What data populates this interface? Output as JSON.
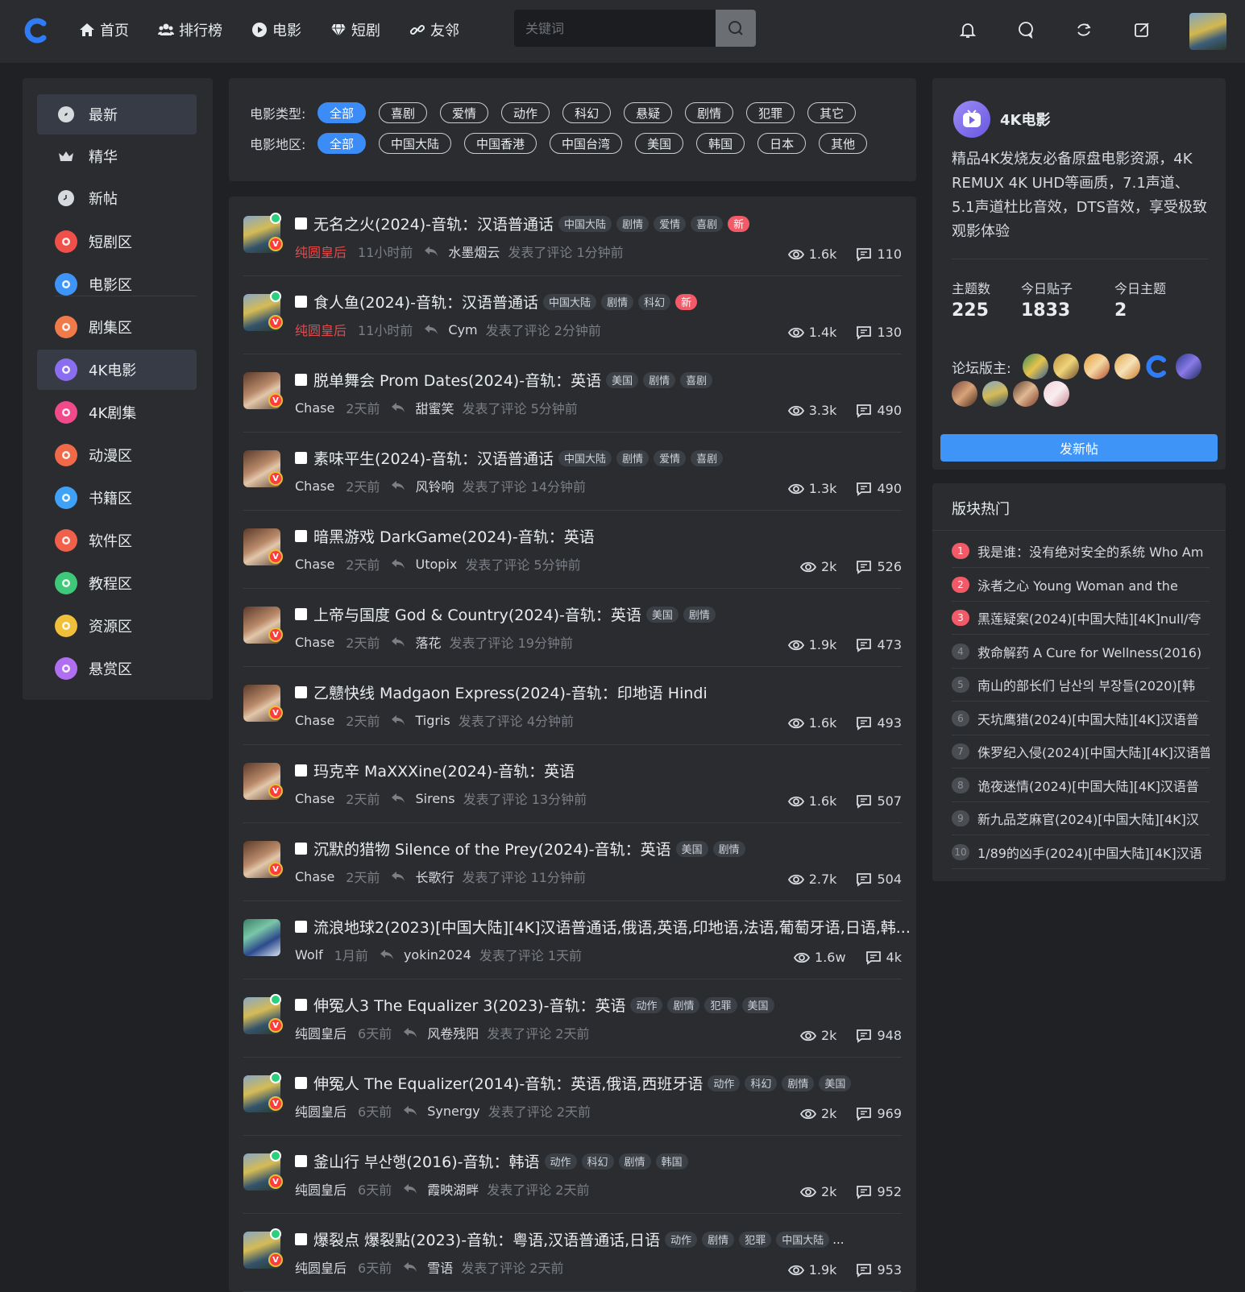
{
  "nav": {
    "items": [
      {
        "label": "首页",
        "icon": "home-icon"
      },
      {
        "label": "排行榜",
        "icon": "users-icon"
      },
      {
        "label": "电影",
        "icon": "play-circle-icon"
      },
      {
        "label": "短剧",
        "icon": "diamond-icon"
      },
      {
        "label": "友邻",
        "icon": "link-icon"
      }
    ],
    "search_placeholder": "关键词"
  },
  "sidebar": {
    "items": [
      {
        "label": "最新",
        "color": "#d6d9de"
      },
      {
        "label": "精华",
        "color": "#d6d9de"
      },
      {
        "label": "新帖",
        "color": "#d6d9de"
      },
      {
        "label": "短剧区",
        "color": "#f0504a"
      },
      {
        "label": "电影区",
        "color": "#3f94f7"
      },
      {
        "label": "剧集区",
        "color": "#f07a4a"
      },
      {
        "label": "4K电影",
        "color": "#8b6ef0"
      },
      {
        "label": "4K剧集",
        "color": "#f04a8a"
      },
      {
        "label": "动漫区",
        "color": "#f06a4a"
      },
      {
        "label": "书籍区",
        "color": "#3fa2f7"
      },
      {
        "label": "软件区",
        "color": "#f0604a"
      },
      {
        "label": "教程区",
        "color": "#3fc77a"
      },
      {
        "label": "资源区",
        "color": "#f0c03a"
      },
      {
        "label": "悬赏区",
        "color": "#b06ef0"
      }
    ]
  },
  "filters": {
    "type_label": "电影类型:",
    "types": [
      "全部",
      "喜剧",
      "爱情",
      "动作",
      "科幻",
      "悬疑",
      "剧情",
      "犯罪",
      "其它"
    ],
    "region_label": "电影地区:",
    "regions": [
      "全部",
      "中国大陆",
      "中国香港",
      "中国台湾",
      "美国",
      "韩国",
      "日本",
      "其他"
    ]
  },
  "posts": [
    {
      "title": "无名之火(2024)-音轨：汉语普通话",
      "tags": [
        "中国大陆",
        "剧情",
        "爱情",
        "喜剧"
      ],
      "new": true,
      "author": "纯圆皇后",
      "author_red": true,
      "avatar": "queen",
      "online": true,
      "time": "11小时前",
      "reply_user": "水墨烟云",
      "reply_text": "发表了评论 1分钟前",
      "views": "1.6k",
      "comments": "110"
    },
    {
      "title": "食人鱼(2024)-音轨：汉语普通话",
      "tags": [
        "中国大陆",
        "剧情",
        "科幻"
      ],
      "new": true,
      "author": "纯圆皇后",
      "author_red": true,
      "avatar": "queen",
      "online": true,
      "time": "11小时前",
      "reply_user": "Cym",
      "reply_text": "发表了评论 2分钟前",
      "views": "1.4k",
      "comments": "130"
    },
    {
      "title": "脱单舞会 Prom Dates(2024)-音轨：英语",
      "tags": [
        "美国",
        "剧情",
        "喜剧"
      ],
      "new": false,
      "author": "Chase",
      "author_red": false,
      "avatar": "chase",
      "online": false,
      "time": "2天前",
      "reply_user": "甜蜜笑",
      "reply_text": "发表了评论 5分钟前",
      "views": "3.3k",
      "comments": "490"
    },
    {
      "title": "素味平生(2024)-音轨：汉语普通话",
      "tags": [
        "中国大陆",
        "剧情",
        "爱情",
        "喜剧"
      ],
      "new": false,
      "author": "Chase",
      "author_red": false,
      "avatar": "chase",
      "online": false,
      "time": "2天前",
      "reply_user": "风铃响",
      "reply_text": "发表了评论 14分钟前",
      "views": "1.3k",
      "comments": "490"
    },
    {
      "title": "暗黑游戏 DarkGame(2024)-音轨：英语",
      "tags": [],
      "new": false,
      "author": "Chase",
      "author_red": false,
      "avatar": "chase",
      "online": false,
      "time": "2天前",
      "reply_user": "Utopix",
      "reply_text": "发表了评论 5分钟前",
      "views": "2k",
      "comments": "526"
    },
    {
      "title": "上帝与国度 God & Country(2024)-音轨：英语",
      "tags": [
        "美国",
        "剧情"
      ],
      "new": false,
      "author": "Chase",
      "author_red": false,
      "avatar": "chase",
      "online": false,
      "time": "2天前",
      "reply_user": "落花",
      "reply_text": "发表了评论 19分钟前",
      "views": "1.9k",
      "comments": "473"
    },
    {
      "title": "乙戆快线 Madgaon Express(2024)-音轨：印地语 Hindi",
      "tags": [],
      "new": false,
      "author": "Chase",
      "author_red": false,
      "avatar": "chase",
      "online": false,
      "time": "2天前",
      "reply_user": "Tigris",
      "reply_text": "发表了评论 4分钟前",
      "views": "1.6k",
      "comments": "493"
    },
    {
      "title": "玛克辛 MaXXXine(2024)-音轨：英语",
      "tags": [],
      "new": false,
      "author": "Chase",
      "author_red": false,
      "avatar": "chase",
      "online": false,
      "time": "2天前",
      "reply_user": "Sirens",
      "reply_text": "发表了评论 13分钟前",
      "views": "1.6k",
      "comments": "507"
    },
    {
      "title": "沉默的猎物 Silence of the Prey(2024)-音轨：英语",
      "tags": [
        "美国",
        "剧情"
      ],
      "new": false,
      "author": "Chase",
      "author_red": false,
      "avatar": "chase",
      "online": false,
      "time": "2天前",
      "reply_user": "长歌行",
      "reply_text": "发表了评论 11分钟前",
      "views": "2.7k",
      "comments": "504"
    },
    {
      "title": "流浪地球2(2023)[中国大陆][4K]汉语普通话,俄语,英语,印地语,法语,葡萄牙语,日语,韩...",
      "tags": [],
      "new": false,
      "author": "Wolf",
      "author_red": false,
      "avatar": "wolf",
      "online": false,
      "vip": false,
      "time": "1月前",
      "reply_user": "yokin2024",
      "reply_text": "发表了评论 1天前",
      "views": "1.6w",
      "comments": "4k"
    },
    {
      "title": "伸冤人3 The Equalizer 3(2023)-音轨：英语",
      "tags": [
        "动作",
        "剧情",
        "犯罪",
        "美国"
      ],
      "new": false,
      "author": "纯圆皇后",
      "author_red": false,
      "avatar": "queen",
      "online": true,
      "time": "6天前",
      "reply_user": "风卷残阳",
      "reply_text": "发表了评论 2天前",
      "views": "2k",
      "comments": "948"
    },
    {
      "title": "伸冤人 The Equalizer(2014)-音轨：英语,俄语,西班牙语",
      "tags": [
        "动作",
        "科幻",
        "剧情",
        "美国"
      ],
      "new": false,
      "author": "纯圆皇后",
      "author_red": false,
      "avatar": "queen",
      "online": true,
      "time": "6天前",
      "reply_user": "Synergy",
      "reply_text": "发表了评论 2天前",
      "views": "2k",
      "comments": "969"
    },
    {
      "title": "釜山行 부산행(2016)-音轨：韩语",
      "tags": [
        "动作",
        "科幻",
        "剧情",
        "韩国"
      ],
      "new": false,
      "author": "纯圆皇后",
      "author_red": false,
      "avatar": "queen",
      "online": true,
      "time": "6天前",
      "reply_user": "霞映湖畔",
      "reply_text": "发表了评论 2天前",
      "views": "2k",
      "comments": "952"
    },
    {
      "title": "爆裂点 爆裂點(2023)-音轨：粤语,汉语普通话,日语",
      "tags": [
        "动作",
        "剧情",
        "犯罪",
        "中国大陆"
      ],
      "ellipsis": "...",
      "new": false,
      "author": "纯圆皇后",
      "author_red": false,
      "avatar": "queen",
      "online": true,
      "time": "6天前",
      "reply_user": "雪语",
      "reply_text": "发表了评论 2天前",
      "views": "1.9k",
      "comments": "953"
    }
  ],
  "forum": {
    "name": "4K电影",
    "description": "精品4K发烧友必备原盘电影资源，4K REMUX 4K UHD等画质，7.1声道、5.1声道杜比音效，DTS音效，享受极致观影体验",
    "stats": [
      {
        "label": "主题数",
        "value": "225"
      },
      {
        "label": "今日贴子",
        "value": "1833"
      },
      {
        "label": "今日主题",
        "value": "2"
      }
    ],
    "moderators_label": "论坛版主:",
    "new_post_button": "发新帖"
  },
  "hot": {
    "title": "版块热门",
    "items": [
      {
        "rank": "1",
        "text": "我是谁：没有绝对安全的系统 Who Am"
      },
      {
        "rank": "2",
        "text": "泳者之心 Young Woman and the"
      },
      {
        "rank": "3",
        "text": "黑莲疑案(2024)[中国大陆][4K]null/夸"
      },
      {
        "rank": "4",
        "text": "救命解药 A Cure for Wellness(2016)"
      },
      {
        "rank": "5",
        "text": "南山的部长们 남산의 부장들(2020)[韩"
      },
      {
        "rank": "6",
        "text": "天坑鹰猎(2024)[中国大陆][4K]汉语普"
      },
      {
        "rank": "7",
        "text": "侏罗纪入侵(2024)[中国大陆][4K]汉语普"
      },
      {
        "rank": "8",
        "text": "诡夜迷情(2024)[中国大陆][4K]汉语普"
      },
      {
        "rank": "9",
        "text": "新九品芝麻官(2024)[中国大陆][4K]汉"
      },
      {
        "rank": "10",
        "text": "1/89的凶手(2024)[中国大陆][4K]汉语"
      }
    ]
  },
  "colors": {
    "accent": "#3b8cf7",
    "new_badge": "#f25a68",
    "online": "#2bcf7c"
  }
}
